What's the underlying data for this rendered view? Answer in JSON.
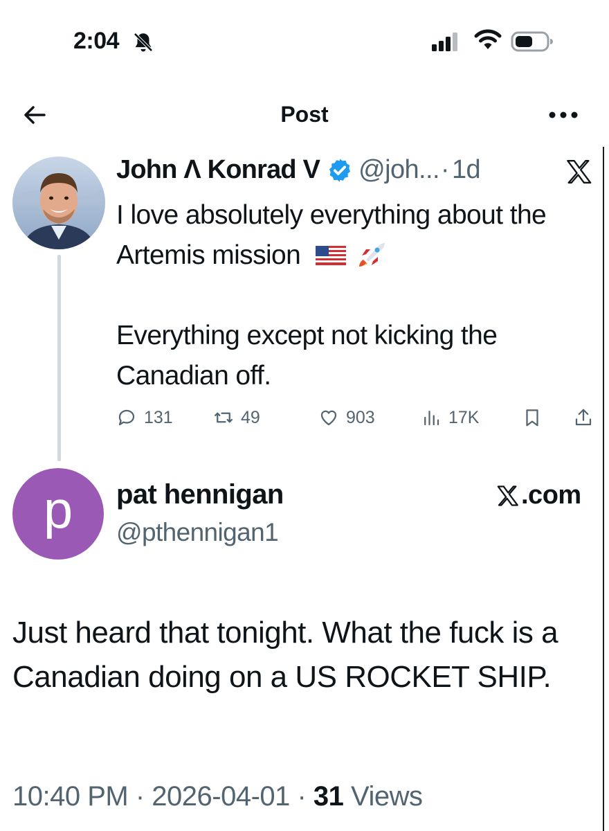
{
  "status_bar": {
    "time": "2:04",
    "icons": [
      "bell-slash-icon",
      "signal-icon",
      "wifi-icon",
      "battery-icon"
    ]
  },
  "nav": {
    "title": "Post",
    "back_icon": "arrow-left-icon",
    "more_icon": "more-horizontal-icon"
  },
  "quoted_post": {
    "author_name": "John Λ Konrad V",
    "verified": true,
    "handle": "@joh...",
    "separator": "·",
    "time_ago": "1d",
    "body_line1": "I love absolutely everything about the Artemis mission",
    "body_emoji": [
      "us-flag",
      "rocket"
    ],
    "body_line2": "Everything except not kicking the Canadian off.",
    "stats": {
      "replies": "131",
      "reposts": "49",
      "likes": "903",
      "views": "17K"
    }
  },
  "reply_post": {
    "avatar_letter": "p",
    "author_name": "pat hennigan",
    "handle": "@pthennigan1",
    "source_suffix": ".com",
    "body": "Just heard that tonight. What the fuck is a Canadian doing on a US ROCKET SHIP.",
    "meta_time": "10:40 PM",
    "meta_date": "2026-04-01",
    "meta_views_count": "31",
    "meta_views_label": "Views",
    "meta_separator": " · "
  },
  "colors": {
    "text_primary": "#0f1419",
    "text_secondary": "#536471",
    "verified_blue": "#1d9bf0",
    "avatar_purple": "#9b59b6",
    "thread_line": "#cfd9de"
  }
}
